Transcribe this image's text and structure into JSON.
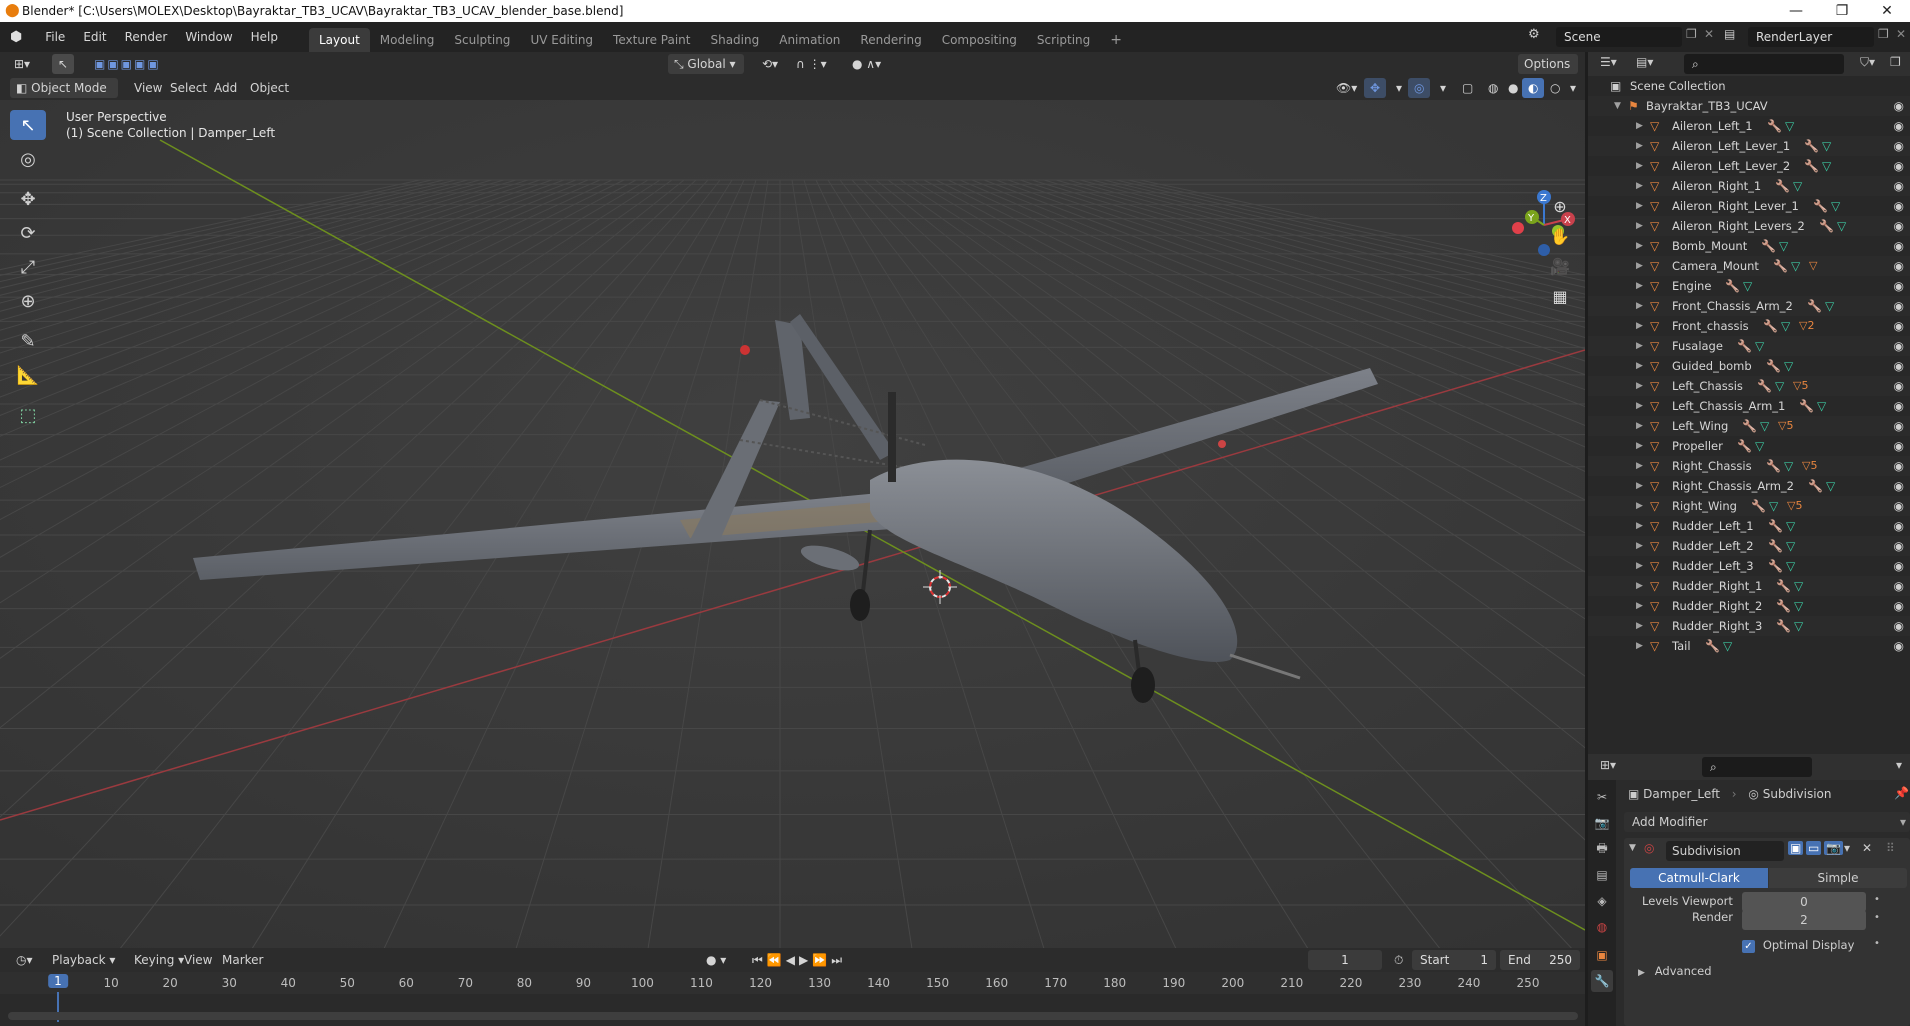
{
  "window": {
    "title": "Blender* [C:\\Users\\MOLEX\\Desktop\\Bayraktar_TB3_UCAV\\Bayraktar_TB3_UCAV_blender_base.blend]"
  },
  "menu": [
    "File",
    "Edit",
    "Render",
    "Window",
    "Help"
  ],
  "workspaces": [
    "Layout",
    "Modeling",
    "Sculpting",
    "UV Editing",
    "Texture Paint",
    "Shading",
    "Animation",
    "Rendering",
    "Compositing",
    "Scripting"
  ],
  "active_workspace": "Layout",
  "scene": {
    "name": "Scene",
    "view_layer": "RenderLayer"
  },
  "viewport_header": {
    "orientation": "Global",
    "options_label": "Options",
    "mode": "Object Mode",
    "menus": [
      "View",
      "Select",
      "Add",
      "Object"
    ]
  },
  "viewport": {
    "perspective_label": "User Perspective",
    "collection_label": "(1) Scene Collection | Damper_Left",
    "gizmo_axes": [
      "Z",
      "Y",
      "X"
    ]
  },
  "outliner": {
    "root": "Scene Collection",
    "collection": "Bayraktar_TB3_UCAV",
    "objects": [
      {
        "name": "Aileron_Left_1",
        "mat": ""
      },
      {
        "name": "Aileron_Left_Lever_1",
        "mat": ""
      },
      {
        "name": "Aileron_Left_Lever_2",
        "mat": ""
      },
      {
        "name": "Aileron_Right_1",
        "mat": ""
      },
      {
        "name": "Aileron_Right_Lever_1",
        "mat": ""
      },
      {
        "name": "Aileron_Right_Levers_2",
        "mat": ""
      },
      {
        "name": "Bomb_Mount",
        "mat": ""
      },
      {
        "name": "Camera_Mount",
        "mat": "▽"
      },
      {
        "name": "Engine",
        "mat": ""
      },
      {
        "name": "Front_Chassis_Arm_2",
        "mat": ""
      },
      {
        "name": "Front_chassis",
        "mat": "▽2"
      },
      {
        "name": "Fusalage",
        "mat": ""
      },
      {
        "name": "Guided_bomb",
        "mat": ""
      },
      {
        "name": "Left_Chassis",
        "mat": "▽5"
      },
      {
        "name": "Left_Chassis_Arm_1",
        "mat": ""
      },
      {
        "name": "Left_Wing",
        "mat": "▽5"
      },
      {
        "name": "Propeller",
        "mat": ""
      },
      {
        "name": "Right_Chassis",
        "mat": "▽5"
      },
      {
        "name": "Right_Chassis_Arm_2",
        "mat": ""
      },
      {
        "name": "Right_Wing",
        "mat": "▽5"
      },
      {
        "name": "Rudder_Left_1",
        "mat": ""
      },
      {
        "name": "Rudder_Left_2",
        "mat": ""
      },
      {
        "name": "Rudder_Left_3",
        "mat": ""
      },
      {
        "name": "Rudder_Right_1",
        "mat": ""
      },
      {
        "name": "Rudder_Right_2",
        "mat": ""
      },
      {
        "name": "Rudder_Right_3",
        "mat": ""
      },
      {
        "name": "Tail",
        "mat": ""
      }
    ]
  },
  "properties": {
    "object": "Damper_Left",
    "modifier_context": "Subdivision",
    "add_modifier": "Add Modifier",
    "modifier_name": "Subdivision",
    "mode_options": [
      "Catmull-Clark",
      "Simple"
    ],
    "active_mode": "Catmull-Clark",
    "levels_viewport_label": "Levels Viewport",
    "levels_viewport": "0",
    "render_label": "Render",
    "render_levels": "2",
    "optimal_display_label": "Optimal Display",
    "optimal_display": true,
    "advanced_label": "Advanced"
  },
  "timeline": {
    "menus": [
      "Playback",
      "Keying",
      "View",
      "Marker"
    ],
    "current_frame": "1",
    "start_label": "Start",
    "start": "1",
    "end_label": "End",
    "end": "250",
    "ruler": [
      "1",
      "10",
      "20",
      "30",
      "40",
      "50",
      "60",
      "70",
      "80",
      "90",
      "100",
      "110",
      "120",
      "130",
      "140",
      "150",
      "160",
      "170",
      "180",
      "190",
      "200",
      "210",
      "220",
      "230",
      "240",
      "250"
    ]
  },
  "colors": {
    "accent": "#4772b3",
    "x_axis": "#c9414c",
    "y_axis": "#7aa31c",
    "z_axis": "#3b78d0",
    "object_orange": "#e9863f",
    "mesh_green": "#3cc7a0"
  }
}
